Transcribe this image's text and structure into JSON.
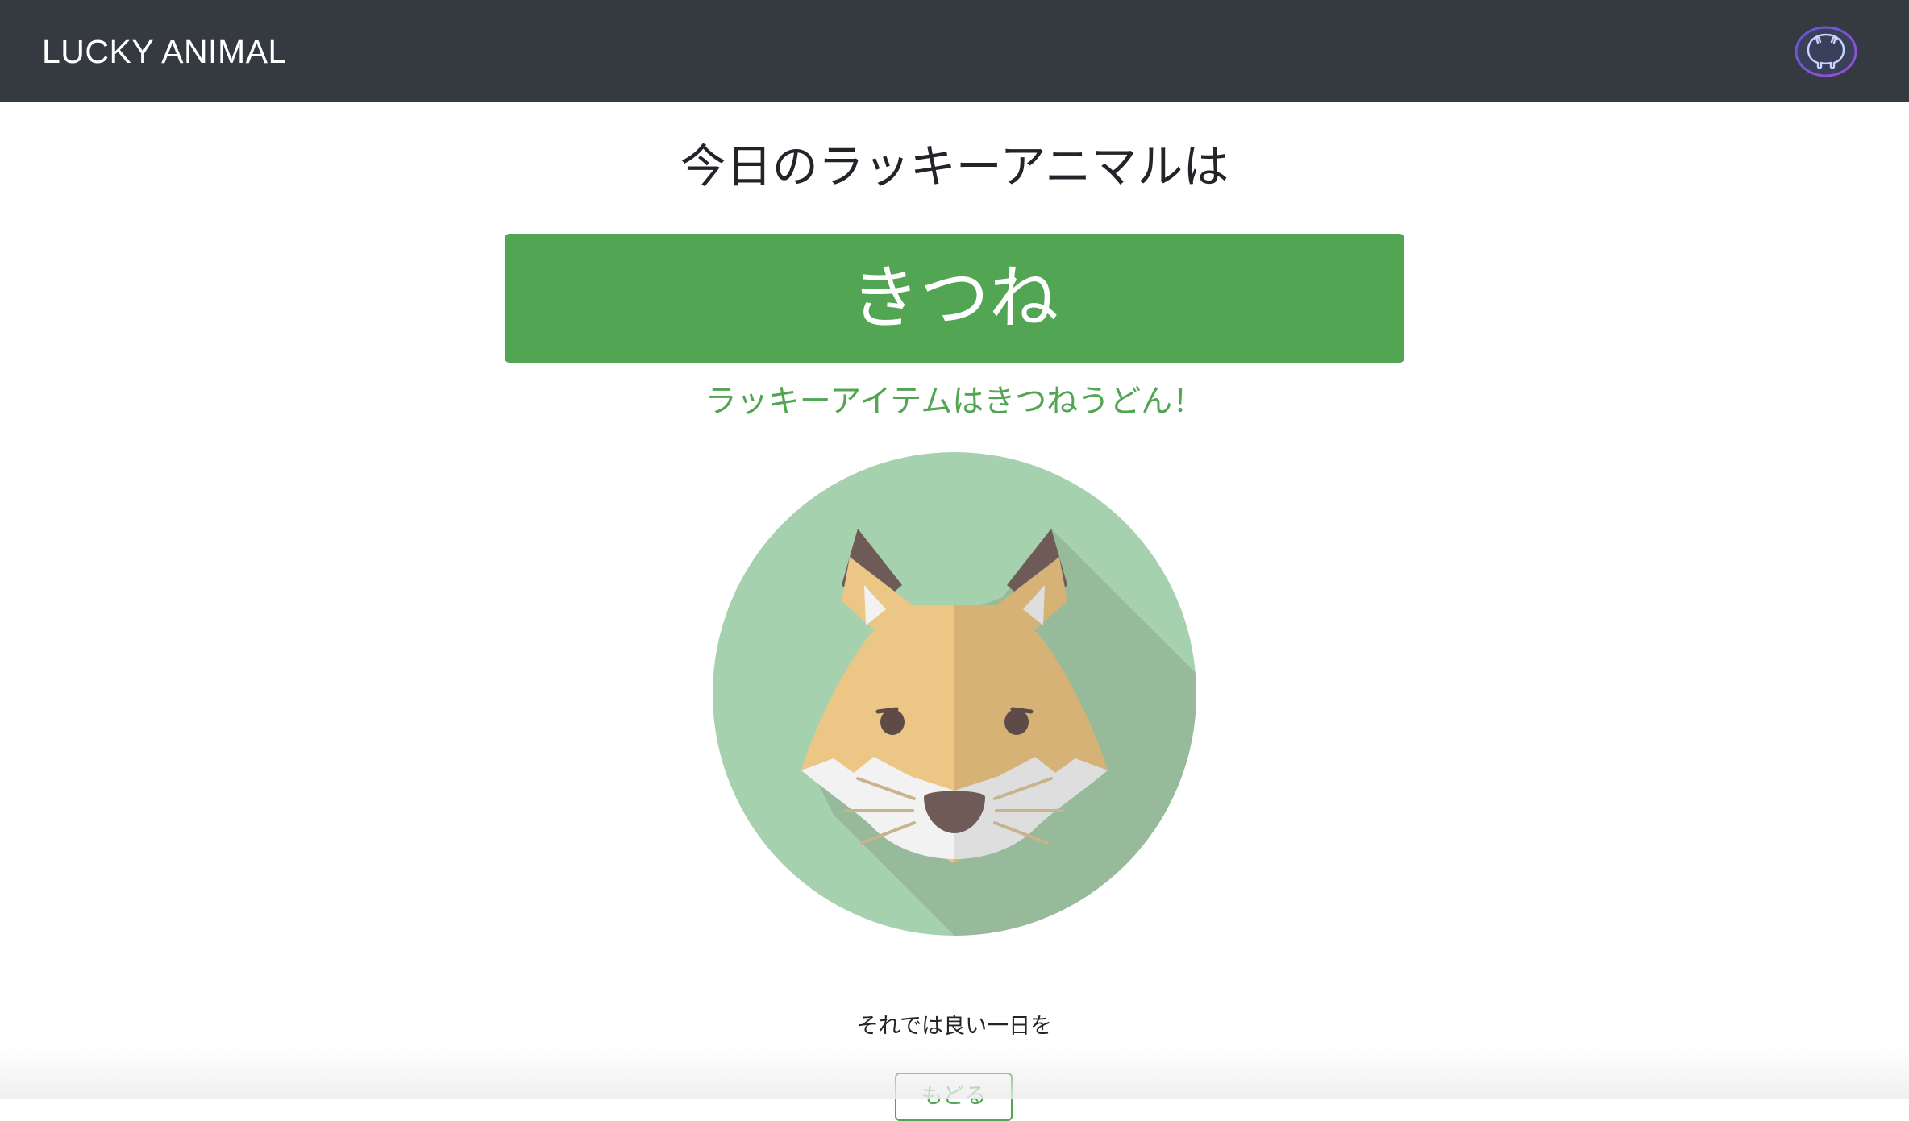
{
  "navbar": {
    "brand": "LUCKY ANIMAL",
    "github_icon": "github-icon"
  },
  "main": {
    "heading": "今日のラッキーアニマルは",
    "animal": "きつね",
    "lucky_item": "ラッキーアイテムはきつねうどん！",
    "illustration": "fox-icon",
    "farewell": "それでは良い一日を",
    "back_button_label": "もどる"
  },
  "colors": {
    "navbar_bg": "#343a40",
    "accent_green": "#52a552",
    "circle_green": "#a6d1ae",
    "text_dark": "#212529"
  }
}
